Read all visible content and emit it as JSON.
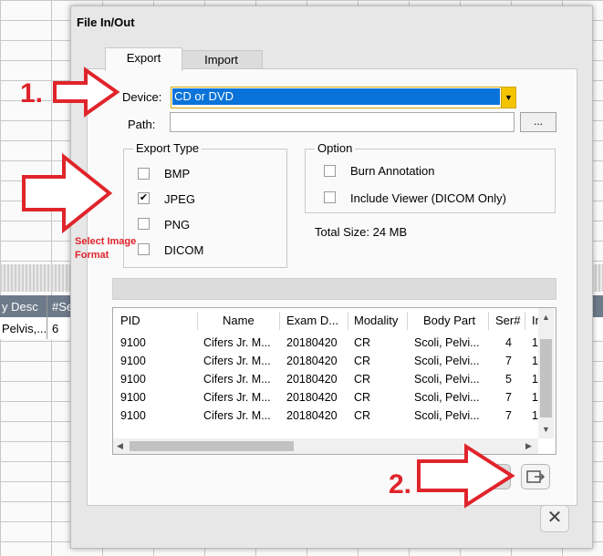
{
  "background": {
    "columns": [
      "y Desc",
      "#Se"
    ],
    "row": [
      "Pelvis,...",
      "6"
    ]
  },
  "dialog": {
    "title": "File In/Out",
    "tabs": [
      {
        "label": "Export",
        "active": true
      },
      {
        "label": "Import",
        "active": false
      }
    ],
    "device_label": "Device:",
    "device_value": "CD or DVD",
    "path_label": "Path:",
    "path_value": "",
    "browse_label": "...",
    "export_type": {
      "title": "Export Type",
      "options": [
        {
          "label": "BMP",
          "checked": false
        },
        {
          "label": "JPEG",
          "checked": true
        },
        {
          "label": "PNG",
          "checked": false
        },
        {
          "label": "DICOM",
          "checked": false
        }
      ]
    },
    "option": {
      "title": "Option",
      "items": [
        {
          "label": "Burn Annotation",
          "checked": false
        },
        {
          "label": "Include Viewer (DICOM Only)",
          "checked": false
        }
      ]
    },
    "total_size": "Total Size: 24 MB",
    "table": {
      "headers": [
        "PID",
        "Name",
        "Exam D...",
        "Modality",
        "Body Part",
        "Ser#",
        "Ir"
      ],
      "rows": [
        [
          "9100",
          "Cifers Jr. M...",
          "20180420",
          "CR",
          "Scoli, Pelvi...",
          "4",
          "1"
        ],
        [
          "9100",
          "Cifers Jr. M...",
          "20180420",
          "CR",
          "Scoli, Pelvi...",
          "7",
          "1"
        ],
        [
          "9100",
          "Cifers Jr. M...",
          "20180420",
          "CR",
          "Scoli, Pelvi...",
          "5",
          "1"
        ],
        [
          "9100",
          "Cifers Jr. M...",
          "20180420",
          "CR",
          "Scoli, Pelvi...",
          "7",
          "1"
        ],
        [
          "9100",
          "Cifers Jr. M...",
          "20180420",
          "CR",
          "Scoli, Pelvi...",
          "7",
          "1"
        ]
      ]
    },
    "icons": [
      "trash-icon",
      "export-icon",
      "close-icon"
    ]
  },
  "annotations": {
    "step1": "1.",
    "step2": "2.",
    "note_line1": "Select Image",
    "note_line2": "Format",
    "color": "#e0242b"
  },
  "colors": {
    "select_highlight": "#0a73d9",
    "dropdown_button": "#f5c400",
    "grid_header": "#6d7a8a"
  }
}
